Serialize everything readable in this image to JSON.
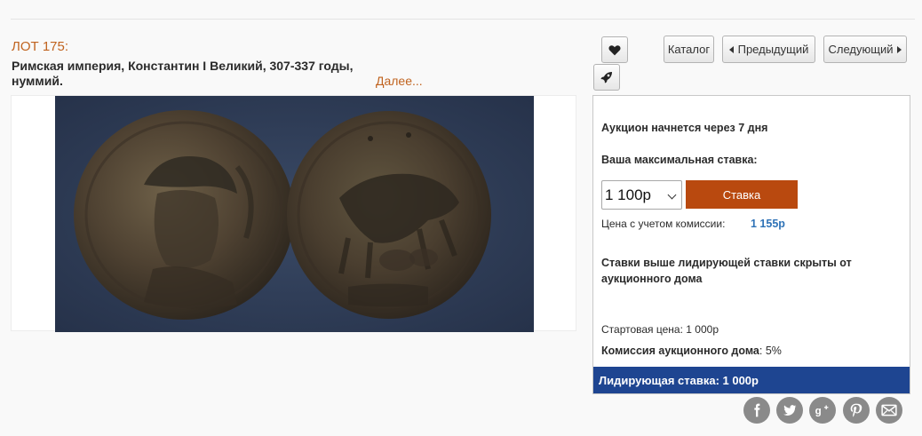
{
  "lot": {
    "number_label": "ЛОТ 175:",
    "title": "Римская империя, Константин I Великий, 307-337 годы, нуммий.",
    "more_link": "Далее..."
  },
  "image": {
    "icon": "coin-photo-obverse-reverse"
  },
  "toolbar": {
    "favorite_icon": "heart-icon",
    "notify_icon": "rocket-icon",
    "catalog_label": "Каталог",
    "prev_label": "Предыдущий",
    "next_label": "Следующий"
  },
  "bid_panel": {
    "auction_starts": "Аукцион начнется через 7 дня",
    "max_bid_label": "Ваша максимальная ставка:",
    "amount_value": "1 100р",
    "bid_button_label": "Ставка",
    "fee_price_label": "Цена с учетом комиссии:",
    "fee_price_value": "1 155р",
    "hidden_bids_note": "Ставки выше лидирующей ставки скрыты от аукционного дома",
    "start_price_label": "Стартовая цена:",
    "start_price_value": "1 000р",
    "commission_label": "Комиссия аукционного дома",
    "commission_value": ": 5%",
    "leading_bid": "Лидирующая ставка: 1 000р"
  },
  "share": {
    "buttons": [
      "facebook-icon",
      "twitter-icon",
      "google-plus-icon",
      "pinterest-icon",
      "email-icon"
    ]
  },
  "colors": {
    "accent_orange": "#c0631f",
    "bid_button": "#b9490f",
    "leading_bar": "#1e4591",
    "fee_blue": "#2f73b7",
    "share_grey": "#8a8a8a"
  }
}
